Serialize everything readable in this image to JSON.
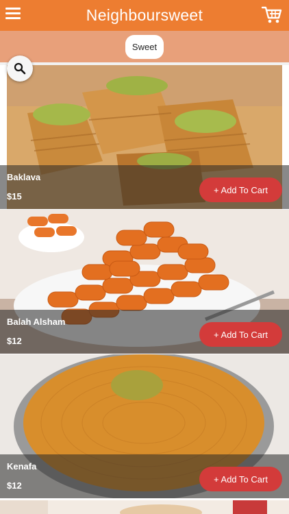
{
  "header": {
    "title": "Neighboursweet",
    "menu_icon": "hamburger-menu-icon",
    "cart_icon": "shopping-cart-icon",
    "color": "#ed7d31"
  },
  "categories": {
    "selected": "Sweet"
  },
  "search": {
    "icon": "search-icon"
  },
  "items": [
    {
      "name": "Baklava",
      "price": "$15",
      "button": "+ Add To Cart"
    },
    {
      "name": "Balah Alsham",
      "price": "$12",
      "button": "+ Add To Cart"
    },
    {
      "name": "Kenafa",
      "price": "$12",
      "button": "+ Add To Cart"
    }
  ],
  "colors": {
    "category_bar": "#e8a07a",
    "add_button": "#d33b3a"
  }
}
